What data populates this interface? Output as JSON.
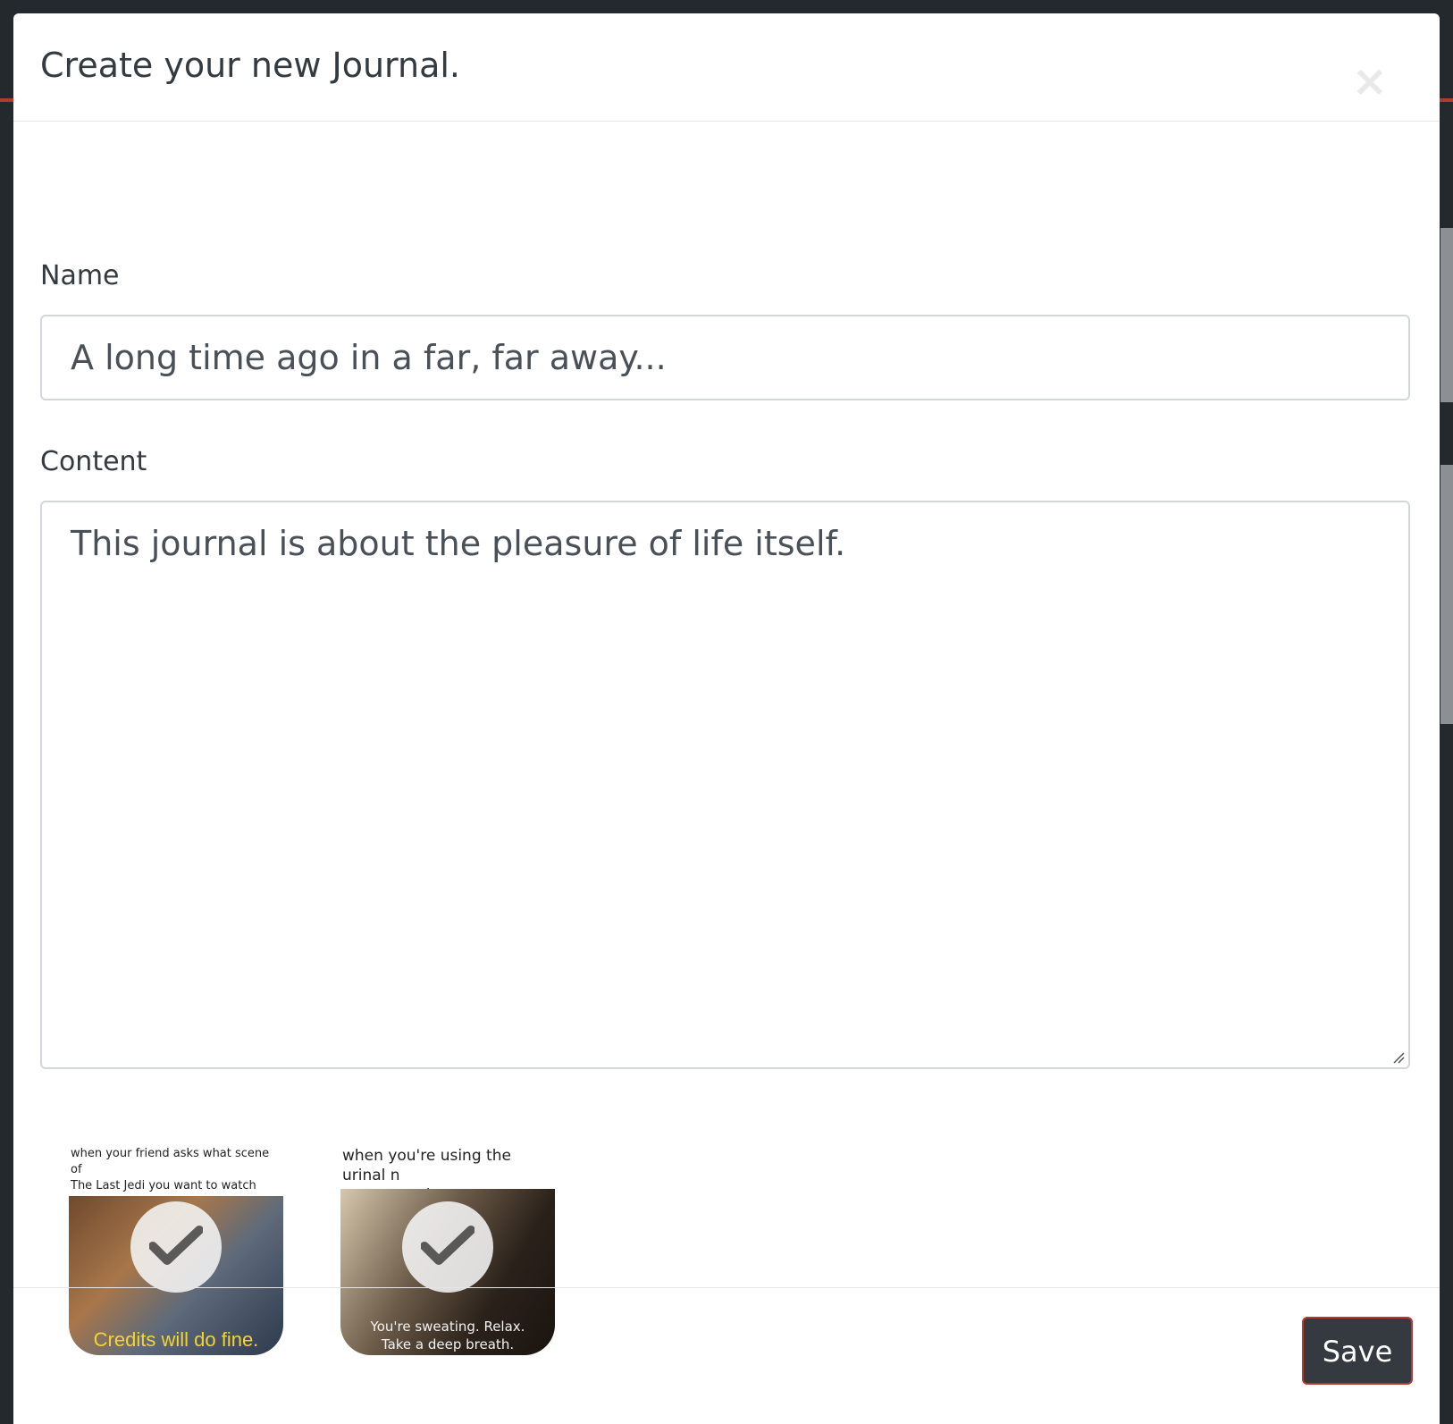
{
  "modal": {
    "title": "Create your new Journal.",
    "close_label": "×"
  },
  "form": {
    "name_label": "Name",
    "name_value": "A long time ago in a far, far away...",
    "content_label": "Content",
    "content_value": "This journal is about the pleasure of life itself."
  },
  "attachments": [
    {
      "top_caption": "when your friend asks what scene of\nThe Last Jedi you want to watch",
      "bottom_caption": "Credits will do fine.",
      "selected": true
    },
    {
      "top_caption": "when you're using the urinal n\nsomeone else:",
      "bottom_caption": "You're sweating. Relax.\nTake a deep breath.",
      "selected": true
    }
  ],
  "footer": {
    "save_label": "Save"
  },
  "colors": {
    "accent_border": "#b33a2f",
    "button_bg": "#343a40",
    "overlay": "#24292e"
  }
}
